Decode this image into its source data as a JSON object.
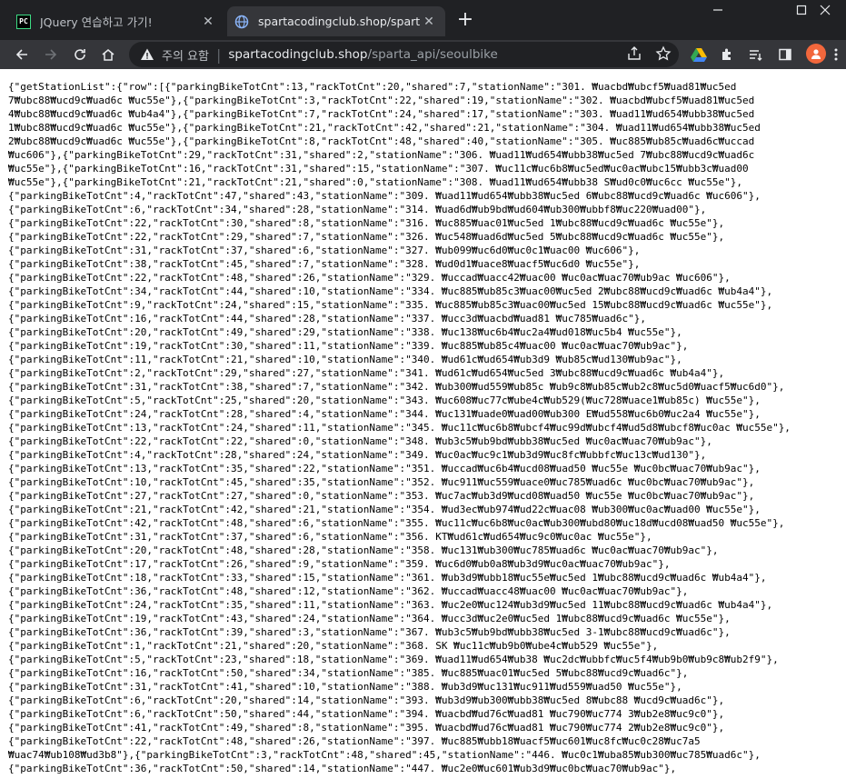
{
  "tabs": [
    {
      "title": "JQuery 연습하고 가기!",
      "favicon": "PC"
    },
    {
      "title": "spartacodingclub.shop/sparta_ap"
    }
  ],
  "omnibox": {
    "security_label": "주의 요함",
    "host": "spartacodingclub.shop",
    "path": "/sparta_api/seoulbike"
  },
  "content_lines": [
    "{\"getStationList\":{\"row\":[{\"parkingBikeTotCnt\":13,\"rackTotCnt\":20,\"shared\":7,\"stationName\":\"301. ₩uacbd₩ubcf5₩uad81₩uc5ed",
    "7₩ubc88₩ucd9c₩uad6c ₩uc55e\"},{\"parkingBikeTotCnt\":3,\"rackTotCnt\":22,\"shared\":19,\"stationName\":\"302. ₩uacbd₩ubcf5₩uad81₩uc5ed",
    "4₩ubc88₩ucd9c₩uad6c ₩ub4a4\"},{\"parkingBikeTotCnt\":7,\"rackTotCnt\":24,\"shared\":17,\"stationName\":\"303. ₩uad11₩ud654₩ubb38₩uc5ed",
    "1₩ubc88₩ucd9c₩uad6c ₩uc55e\"},{\"parkingBikeTotCnt\":21,\"rackTotCnt\":42,\"shared\":21,\"stationName\":\"304. ₩uad11₩ud654₩ubb38₩uc5ed",
    "2₩ubc88₩ucd9c₩uad6c ₩uc55e\"},{\"parkingBikeTotCnt\":8,\"rackTotCnt\":48,\"shared\":40,\"stationName\":\"305. ₩uc885₩ub85c₩uad6c₩uccad",
    "₩uc606\"},{\"parkingBikeTotCnt\":29,\"rackTotCnt\":31,\"shared\":2,\"stationName\":\"306. ₩uad11₩ud654₩ubb38₩uc5ed 7₩ubc88₩ucd9c₩uad6c",
    "₩uc55e\"},{\"parkingBikeTotCnt\":16,\"rackTotCnt\":31,\"shared\":15,\"stationName\":\"307. ₩uc11c₩uc6b8₩uc5ed₩uc0ac₩ubc15₩ubb3c₩uad00",
    "₩uc55e\"},{\"parkingBikeTotCnt\":21,\"rackTotCnt\":21,\"shared\":0,\"stationName\":\"308. ₩uad11₩ud654₩ubb38 S₩ud0c0₩uc6cc ₩uc55e\"},",
    "{\"parkingBikeTotCnt\":4,\"rackTotCnt\":47,\"shared\":43,\"stationName\":\"309. ₩uad11₩ud654₩ubb38₩uc5ed 6₩ubc88₩ucd9c₩uad6c ₩uc606\"},",
    "{\"parkingBikeTotCnt\":6,\"rackTotCnt\":34,\"shared\":28,\"stationName\":\"314. ₩uad6d₩ub9bd₩ud604₩ub300₩ubbf8₩uc220₩uad00\"},",
    "{\"parkingBikeTotCnt\":22,\"rackTotCnt\":30,\"shared\":8,\"stationName\":\"316. ₩uc885₩uac01₩uc5ed 1₩ubc88₩ucd9c₩uad6c ₩uc55e\"},",
    "{\"parkingBikeTotCnt\":22,\"rackTotCnt\":29,\"shared\":7,\"stationName\":\"326. ₩uc548₩uad6d₩uc5ed 5₩ubc88₩ucd9c₩uad6c ₩uc55e\"},",
    "{\"parkingBikeTotCnt\":31,\"rackTotCnt\":37,\"shared\":6,\"stationName\":\"327. ₩ub099₩uc6d0₩uc0c1₩uac00 ₩uc606\"},",
    "{\"parkingBikeTotCnt\":38,\"rackTotCnt\":45,\"shared\":7,\"stationName\":\"328. ₩ud0d1₩uace8₩uacf5₩uc6d0 ₩uc55e\"},",
    "{\"parkingBikeTotCnt\":22,\"rackTotCnt\":48,\"shared\":26,\"stationName\":\"329. ₩uccad₩uacc42₩uac00 ₩uc0ac₩uac70₩ub9ac ₩uc606\"},",
    "{\"parkingBikeTotCnt\":34,\"rackTotCnt\":44,\"shared\":10,\"stationName\":\"334. ₩uc885₩ub85c3₩uac00₩uc5ed 2₩ubc88₩ucd9c₩uad6c ₩ub4a4\"},",
    "{\"parkingBikeTotCnt\":9,\"rackTotCnt\":24,\"shared\":15,\"stationName\":\"335. ₩uc885₩ub85c3₩uac00₩uc5ed 15₩ubc88₩ucd9c₩uad6c ₩uc55e\"},",
    "{\"parkingBikeTotCnt\":16,\"rackTotCnt\":44,\"shared\":28,\"stationName\":\"337. ₩ucc3d₩uacbd₩uad81 ₩uc785₩uad6c\"},",
    "{\"parkingBikeTotCnt\":20,\"rackTotCnt\":49,\"shared\":29,\"stationName\":\"338. ₩uc138₩uc6b4₩uc2a4₩ud018₩uc5b4 ₩uc55e\"},",
    "{\"parkingBikeTotCnt\":19,\"rackTotCnt\":30,\"shared\":11,\"stationName\":\"339. ₩uc885₩ub85c4₩uac00 ₩uc0ac₩uac70₩ub9ac\"},",
    "{\"parkingBikeTotCnt\":11,\"rackTotCnt\":21,\"shared\":10,\"stationName\":\"340. ₩ud61c₩ud654₩ub3d9 ₩ub85c₩ud130₩ub9ac\"},",
    "{\"parkingBikeTotCnt\":2,\"rackTotCnt\":29,\"shared\":27,\"stationName\":\"341. ₩ud61c₩ud654₩uc5ed 3₩ubc88₩ucd9c₩uad6c ₩ub4a4\"},",
    "{\"parkingBikeTotCnt\":31,\"rackTotCnt\":38,\"shared\":7,\"stationName\":\"342. ₩ub300₩ud559₩ub85c ₩ub9c8₩ub85c₩ub2c8₩uc5d0₩uacf5₩uc6d0\"},",
    "{\"parkingBikeTotCnt\":5,\"rackTotCnt\":25,\"shared\":20,\"stationName\":\"343. ₩uc608₩uc77c₩ube4c₩ub529(₩uc728₩uace1₩ub85c) ₩uc55e\"},",
    "{\"parkingBikeTotCnt\":24,\"rackTotCnt\":28,\"shared\":4,\"stationName\":\"344. ₩uc131₩uade0₩uad00₩ub300 E₩ud558₩uc6b0₩uc2a4 ₩uc55e\"},",
    "{\"parkingBikeTotCnt\":13,\"rackTotCnt\":24,\"shared\":11,\"stationName\":\"345. ₩uc11c₩uc6b8₩ubcf4₩uc99d₩ubcf4₩ud5d8₩ubcf8₩uc0ac ₩uc55e\"},",
    "{\"parkingBikeTotCnt\":22,\"rackTotCnt\":22,\"shared\":0,\"stationName\":\"348. ₩ub3c5₩ub9bd₩ubb38₩uc5ed ₩uc0ac₩uac70₩ub9ac\"},",
    "{\"parkingBikeTotCnt\":4,\"rackTotCnt\":28,\"shared\":24,\"stationName\":\"349. ₩uc0ac₩uc9c1₩ub3d9₩uc8fc₩ubbfc₩uc13c₩ud130\"},",
    "{\"parkingBikeTotCnt\":13,\"rackTotCnt\":35,\"shared\":22,\"stationName\":\"351. ₩uccad₩uc6b4₩ucd08₩uad50 ₩uc55e ₩uc0bc₩uac70₩ub9ac\"},",
    "{\"parkingBikeTotCnt\":10,\"rackTotCnt\":45,\"shared\":35,\"stationName\":\"352. ₩uc911₩uc559₩uace0₩uc785₩uad6c ₩uc0bc₩uac70₩ub9ac\"},",
    "{\"parkingBikeTotCnt\":27,\"rackTotCnt\":27,\"shared\":0,\"stationName\":\"353. ₩uc7ac₩ub3d9₩ucd08₩uad50 ₩uc55e ₩uc0bc₩uac70₩ub9ac\"},",
    "{\"parkingBikeTotCnt\":21,\"rackTotCnt\":42,\"shared\":21,\"stationName\":\"354. ₩ud3ec₩ub974₩ud22c₩uac08 ₩ub300₩uc0ac₩uad00 ₩uc55e\"},",
    "{\"parkingBikeTotCnt\":42,\"rackTotCnt\":48,\"shared\":6,\"stationName\":\"355. ₩uc11c₩uc6b8₩uc0ac₩ub300₩ubd80₩uc18d₩ucd08₩uad50 ₩uc55e\"},",
    "{\"parkingBikeTotCnt\":31,\"rackTotCnt\":37,\"shared\":6,\"stationName\":\"356. KT₩ud61c₩ud654₩uc9c0₩uc0ac ₩uc55e\"},",
    "{\"parkingBikeTotCnt\":20,\"rackTotCnt\":48,\"shared\":28,\"stationName\":\"358. ₩uc131₩ub300₩uc785₩uad6c ₩uc0ac₩uac70₩ub9ac\"},",
    "{\"parkingBikeTotCnt\":17,\"rackTotCnt\":26,\"shared\":9,\"stationName\":\"359. ₩uc6d0₩ub0a8₩ub3d9₩uc0ac₩uac70₩ub9ac\"},",
    "{\"parkingBikeTotCnt\":18,\"rackTotCnt\":33,\"shared\":15,\"stationName\":\"361. ₩ub3d9₩ubb18₩uc55e₩uc5ed 1₩ubc88₩ucd9c₩uad6c ₩ub4a4\"},",
    "{\"parkingBikeTotCnt\":36,\"rackTotCnt\":48,\"shared\":12,\"stationName\":\"362. ₩uccad₩uacc48₩uac00 ₩uc0ac₩uac70₩ub9ac\"},",
    "{\"parkingBikeTotCnt\":24,\"rackTotCnt\":35,\"shared\":11,\"stationName\":\"363. ₩uc2e0₩uc124₩ub3d9₩uc5ed 11₩ubc88₩ucd9c₩uad6c ₩ub4a4\"},",
    "{\"parkingBikeTotCnt\":19,\"rackTotCnt\":43,\"shared\":24,\"stationName\":\"364. ₩ucc3d₩uc2e0₩uc5ed 1₩ubc88₩ucd9c₩uad6c ₩uc55e\"},",
    "{\"parkingBikeTotCnt\":36,\"rackTotCnt\":39,\"shared\":3,\"stationName\":\"367. ₩ub3c5₩ub9bd₩ubb38₩uc5ed 3-1₩ubc88₩ucd9c₩uad6c\"},",
    "{\"parkingBikeTotCnt\":1,\"rackTotCnt\":21,\"shared\":20,\"stationName\":\"368. SK ₩uc11c₩ub9b0₩ube4c₩ub529 ₩uc55e\"},",
    "{\"parkingBikeTotCnt\":5,\"rackTotCnt\":23,\"shared\":18,\"stationName\":\"369. ₩uad11₩ud654₩ub38 ₩uc2dc₩ubbfc₩uc5f4₩ub9b0₩ub9c8₩ub2f9\"},",
    "{\"parkingBikeTotCnt\":16,\"rackTotCnt\":50,\"shared\":34,\"stationName\":\"385. ₩uc885₩uac01₩uc5ed 5₩ubc88₩ucd9c₩uad6c\"},",
    "{\"parkingBikeTotCnt\":31,\"rackTotCnt\":41,\"shared\":10,\"stationName\":\"388. ₩ub3d9₩uc131₩uc911₩ud559₩uad50 ₩uc55e\"},",
    "{\"parkingBikeTotCnt\":6,\"rackTotCnt\":20,\"shared\":14,\"stationName\":\"393. ₩ub3d9₩ub300₩ubb38₩uc5ed 8₩ubc88 ₩ucd9c₩uad6c\"},",
    "{\"parkingBikeTotCnt\":6,\"rackTotCnt\":50,\"shared\":44,\"stationName\":\"394. ₩uacbd₩ud76c₩uad81 ₩uc790₩uc774 3₩ub2e8₩uc9c0\"},",
    "{\"parkingBikeTotCnt\":41,\"rackTotCnt\":49,\"shared\":8,\"stationName\":\"395. ₩uacbd₩ud76c₩uad81 ₩uc790₩uc774 2₩ub2e8₩uc9c0\"},",
    "{\"parkingBikeTotCnt\":22,\"rackTotCnt\":48,\"shared\":26,\"stationName\":\"397. ₩uc885₩ubb18₩uacf5₩uc601₩uc8fc₩uc0c28₩uc7a5",
    "₩uac74₩ub108₩ud3b8\"},{\"parkingBikeTotCnt\":3,\"rackTotCnt\":48,\"shared\":45,\"stationName\":\"446. ₩uc0c1₩uba85₩ub300₩uc785₩uad6c\"},",
    "{\"parkingBikeTotCnt\":36,\"rackTotCnt\":50,\"shared\":14,\"stationName\":\"447. ₩uc2e0₩uc601₩ub3d9₩uc0bc₩uac70₩ub9ac\"},"
  ]
}
